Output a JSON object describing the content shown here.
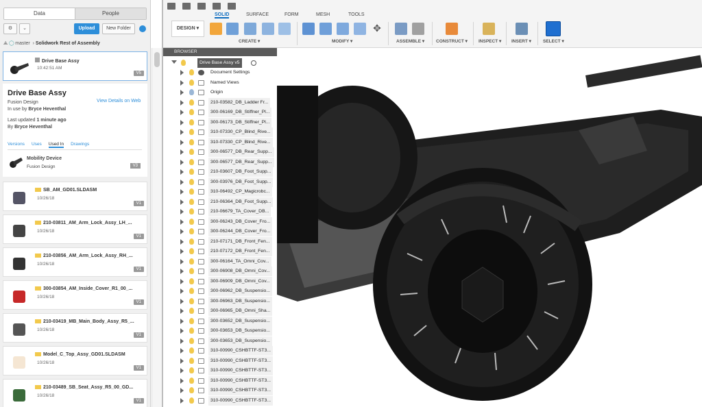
{
  "left_panel": {
    "tabs": {
      "data": "Data",
      "people": "People"
    },
    "upload_label": "Upload",
    "new_folder_label": "New Folder",
    "breadcrumb": {
      "branch": "master",
      "folder": "Solidwork Rest of Assembly"
    },
    "selected": {
      "name": "Drive Base Assy",
      "time": "10:42:51 AM",
      "version": "V5"
    },
    "detail": {
      "title": "Drive Base Assy",
      "type": "Fusion Design",
      "in_use_prefix": "In use by",
      "in_use_by": "Bryce Heventhal",
      "view_details": "View Details on Web",
      "updated_prefix": "Last updated",
      "updated": "1 minute ago",
      "by_prefix": "By",
      "by": "Bryce Heventhal",
      "subtabs": [
        "Versions",
        "Uses",
        "Used In",
        "Drawings"
      ],
      "used_in": {
        "name": "Mobility Device",
        "type": "Fusion Design",
        "version": "V3"
      }
    },
    "files": [
      {
        "name": "SB_AM_GD01.SLDASM",
        "date": "10/26/18",
        "version": "V1"
      },
      {
        "name": "210-03811_AM_Arm_Lock_Assy_LH_...",
        "date": "10/26/18",
        "version": "V1"
      },
      {
        "name": "210-03856_AM_Arm_Lock_Assy_RH_...",
        "date": "10/26/18",
        "version": "V1"
      },
      {
        "name": "300-03854_AM_Inside_Cover_R1_00_...",
        "date": "10/26/18",
        "version": "V1"
      },
      {
        "name": "210-03419_MB_Main_Body_Assy_R5_...",
        "date": "10/26/18",
        "version": "V1"
      },
      {
        "name": "Model_C_Top_Assy_GD01.SLDASM",
        "date": "10/26/18",
        "version": "V1"
      },
      {
        "name": "210-03489_SB_Seat_Assy_R5_00_GD...",
        "date": "10/26/18",
        "version": "V1"
      }
    ]
  },
  "toolbar": {
    "tabs": [
      "SOLID",
      "SURFACE",
      "FORM",
      "MESH",
      "TOOLS"
    ],
    "workspace": "DESIGN",
    "groups": [
      "CREATE",
      "MODIFY",
      "ASSEMBLE",
      "CONSTRUCT",
      "INSPECT",
      "INSERT",
      "SELECT"
    ]
  },
  "browser": {
    "header": "BROWSER",
    "root": "Drive Base Assy v5",
    "items": [
      "Document Settings",
      "Named Views",
      "Origin",
      "210-03582_DB_Ladder Fr...",
      "300-06169_DB_Stiffner_Pl...",
      "300-06173_DB_Stiffner_Pl...",
      "310-07330_CP_Blind_Rive...",
      "310-07330_CP_Blind_Rive...",
      "300-06577_DB_Rear_Supp...",
      "300-06577_DB_Rear_Supp...",
      "210-03607_DB_Foot_Supp...",
      "300-03976_DB_Foot_Supp...",
      "310-06492_CP_Magicrobc...",
      "210-06364_DB_Foot_Supp...",
      "210-06679_TA_Cover_DB...",
      "300-06243_DB_Cover_Fro...",
      "300-06244_DB_Cover_Fro...",
      "210-07171_DB_Front_Fen...",
      "210-07172_DB_Front_Fen...",
      "300-06164_TA_Omni_Cov...",
      "300-06908_DB_Omni_Cov...",
      "300-06909_DB_Omni_Cov...",
      "300-06962_DB_Suspensio...",
      "300-06963_DB_Suspensio...",
      "300-06965_DB_Omni_Sha...",
      "300-03652_DB_Suspensio...",
      "300-03653_DB_Suspensio...",
      "300-03653_DB_Suspensio...",
      "310-00990_CSHBTTF-ST3...",
      "310-00990_CSHBTTF-ST3...",
      "310-00990_CSHBTTF-ST3...",
      "310-00990_CSHBTTF-ST3...",
      "310-00990_CSHBTTF-ST3...",
      "310-00990_CSHBTTF-ST3..."
    ]
  },
  "colors": {
    "accent": "#2d8ed9",
    "bulb": "#f2c94c",
    "model": "#1b1b1b"
  }
}
